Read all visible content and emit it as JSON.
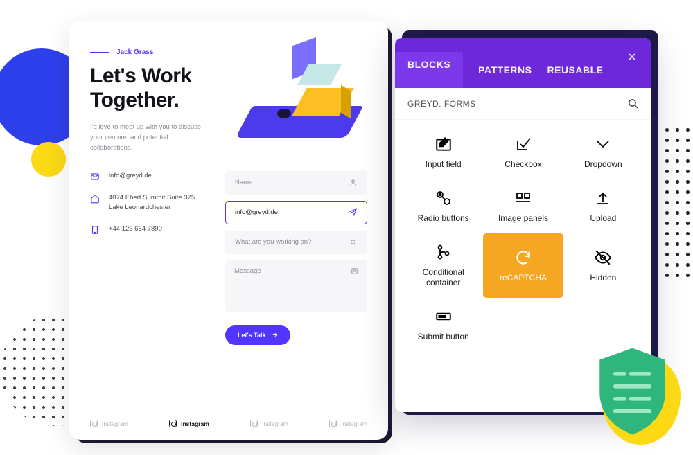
{
  "contact_card": {
    "eyebrow": "Jack Grass",
    "heading_l1": "Let's Work",
    "heading_l2": "Together.",
    "subtext": "I'd love to meet up with you to discuss your venture, and potential collaborations.",
    "email": "info@greyd.de.",
    "address": "4074 Ebert Summit Suite 375 Lake Leonardchester",
    "phone": "+44 123 654 7890",
    "form": {
      "name_placeholder": "Name",
      "email_value": "info@greyd.de.",
      "topic_placeholder": "What are you working on?",
      "message_placeholder": "Message",
      "submit_label": "Let's Talk"
    },
    "social": "Instagram"
  },
  "blocks_panel": {
    "tabs": {
      "blocks": "BLOCKS",
      "patterns": "PATTERNS",
      "reusable": "REUSABLE"
    },
    "section_label": "GREYD. FORMS",
    "items": [
      "Input field",
      "Checkbox",
      "Dropdown",
      "Radio buttons",
      "Image panels",
      "Upload",
      "Conditional container",
      "reCAPTCHA",
      "Hidden",
      "Submit button"
    ]
  }
}
